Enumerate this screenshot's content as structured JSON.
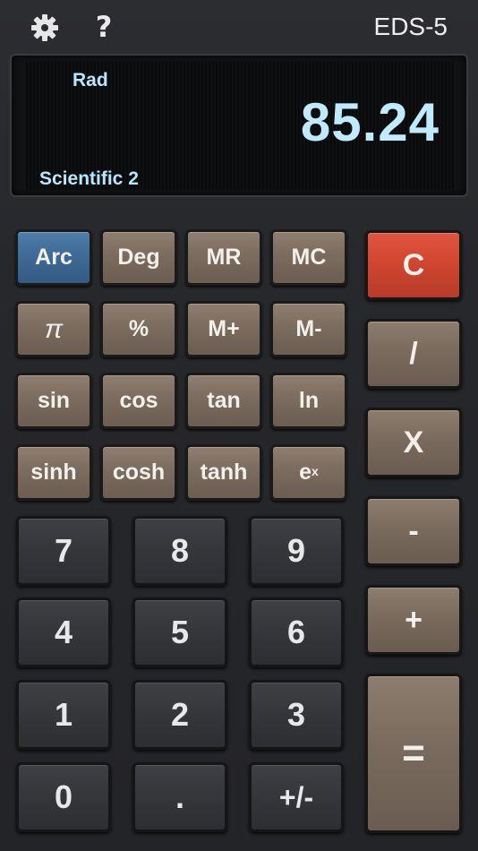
{
  "header": {
    "settings_icon": "gear-icon",
    "help_label": "?",
    "model": "EDS-5"
  },
  "display": {
    "angle_mode": "Rad",
    "value": "85.24",
    "layout": "Scientific 2"
  },
  "keys": {
    "arc": "Arc",
    "deg": "Deg",
    "mr": "MR",
    "mc": "MC",
    "pi": "π",
    "percent": "%",
    "mplus": "M+",
    "mminus": "M-",
    "sin": "sin",
    "cos": "cos",
    "tan": "tan",
    "ln": "ln",
    "sinh": "sinh",
    "cosh": "cosh",
    "tanh": "tanh",
    "exp_base": "e",
    "exp_sup": "x",
    "n7": "7",
    "n8": "8",
    "n9": "9",
    "n4": "4",
    "n5": "5",
    "n6": "6",
    "n1": "1",
    "n2": "2",
    "n3": "3",
    "n0": "0",
    "dot": ".",
    "sign": "+/-",
    "clear": "C",
    "divide": "/",
    "multiply": "X",
    "minus": "-",
    "plus": "+",
    "equals": "="
  },
  "colors": {
    "arc_key": "#3f6b95",
    "clear_key": "#cf4530",
    "display_text": "#bfeaff"
  }
}
